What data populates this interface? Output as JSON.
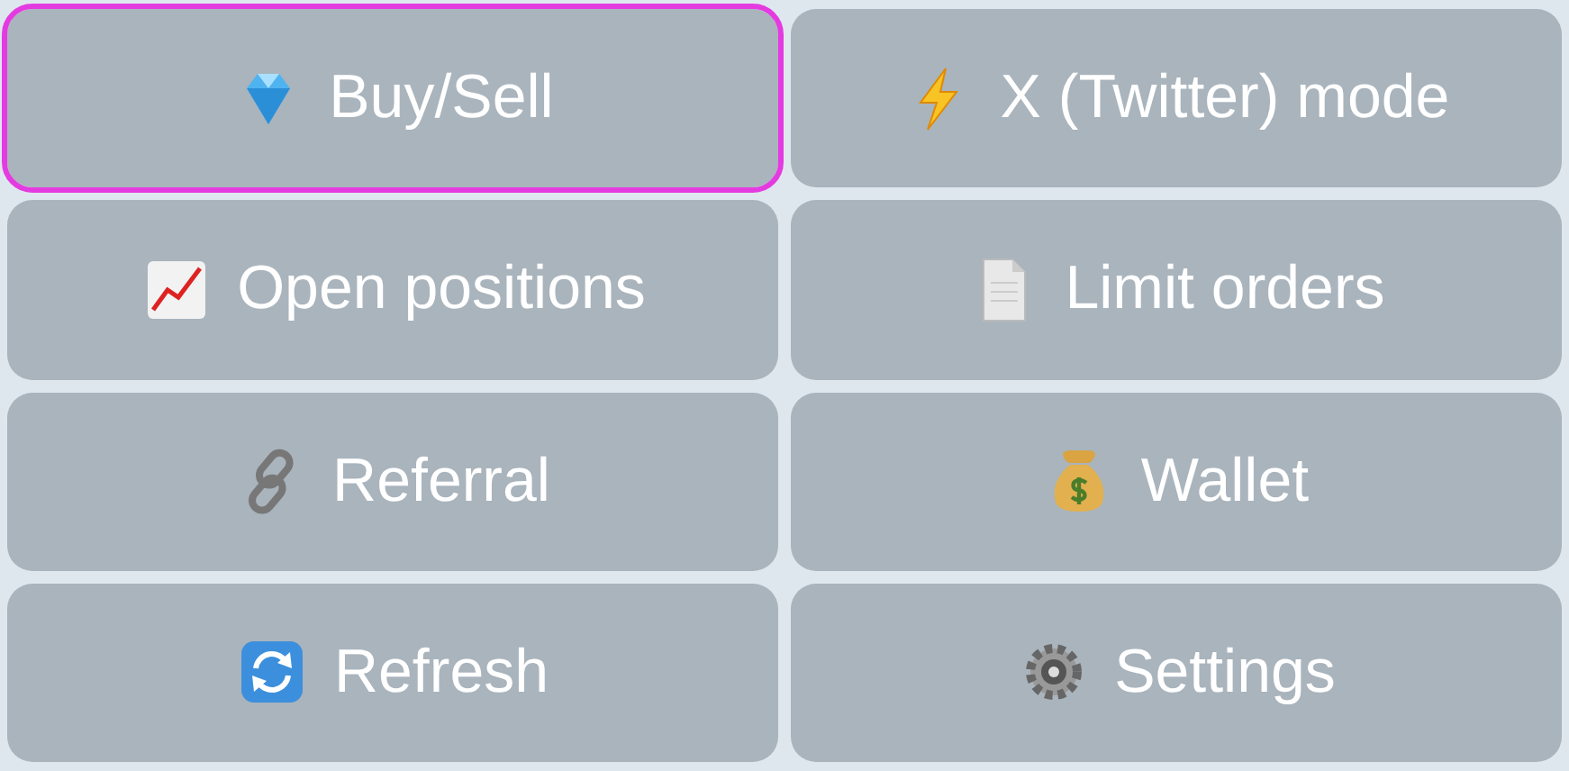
{
  "keyboard": {
    "buttons": [
      {
        "label": "Buy/Sell",
        "selected": true
      },
      {
        "label": "X (Twitter) mode",
        "selected": false
      },
      {
        "label": "Open positions",
        "selected": false
      },
      {
        "label": "Limit orders",
        "selected": false
      },
      {
        "label": "Referral",
        "selected": false
      },
      {
        "label": "Wallet",
        "selected": false
      },
      {
        "label": "Refresh",
        "selected": false
      },
      {
        "label": "Settings",
        "selected": false
      }
    ]
  }
}
